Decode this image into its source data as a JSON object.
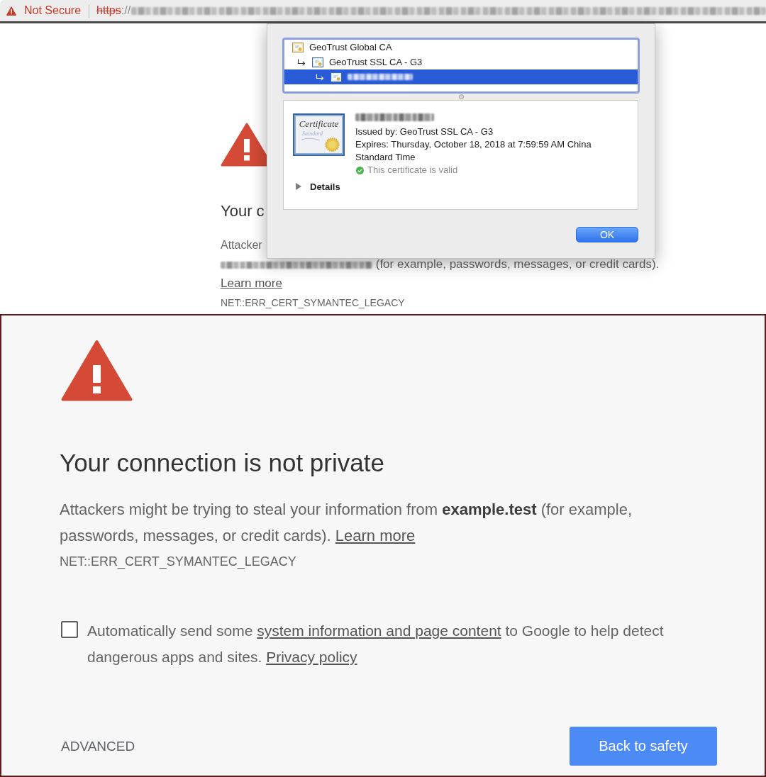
{
  "address_bar": {
    "security_label": "Not Secure",
    "url_scheme": "https",
    "url_separator": "://"
  },
  "background_page": {
    "heading": "Your c",
    "body_start": "Attacker",
    "body_rest": "(for example, passwords, messages, or credit cards).",
    "learn_more": "Learn more",
    "error_code": "NET::ERR_CERT_SYMANTEC_LEGACY"
  },
  "certificate_dialog": {
    "chain": [
      {
        "label": "GeoTrust Global CA",
        "kind": "root",
        "selected": false,
        "children": [
          {
            "label": "GeoTrust SSL CA - G3",
            "kind": "intermediate",
            "selected": false,
            "children": [
              {
                "kind": "leaf",
                "selected": true
              }
            ]
          }
        ]
      }
    ],
    "certificate": {
      "icon_caption": "Certificate",
      "icon_subcaption": "Standard",
      "issued_by": "Issued by: GeoTrust SSL CA - G3",
      "expires": "Expires: Thursday, October 18, 2018 at 7:59:59 AM China Standard Time",
      "status": "This certificate is valid",
      "valid": true,
      "details": {
        "label": "Details",
        "expanded": false
      }
    },
    "ok_button": "OK"
  },
  "interstitial": {
    "heading": "Your connection is not private",
    "body": "Attackers might be trying to steal your information from **example.test** (for example, passwords, messages, or credit cards).",
    "learn_more": "Learn more",
    "error_code": "NET::ERR_CERT_SYMANTEC_LEGACY",
    "report": {
      "checked": false,
      "text_before": "Automatically send some",
      "link": "system information and page content",
      "text_after": "to Google to help detect dangerous apps and sites.",
      "privacy_link": "Privacy policy"
    },
    "advanced": "ADVANCED",
    "back_button": "Back to safety"
  }
}
